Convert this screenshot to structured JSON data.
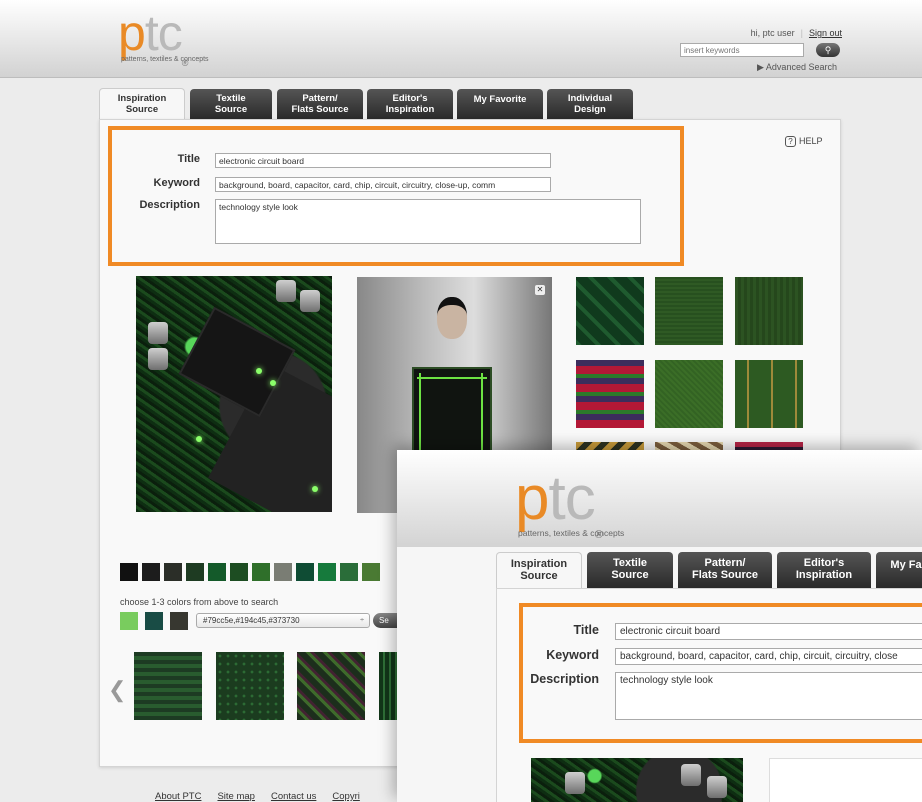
{
  "brand": {
    "logo_p": "p",
    "logo_tc": "tc",
    "logo_reg": "®",
    "tagline": "patterns, textiles & concepts",
    "orange": "#f08a25"
  },
  "user": {
    "greeting": "hi, ptc user",
    "separator": "|",
    "sign_out": "Sign out"
  },
  "search": {
    "placeholder": "insert keywords",
    "button_icon": "search-icon",
    "advanced": "▶ Advanced Search"
  },
  "tabs": [
    {
      "line1": "Inspiration",
      "line2": "Source"
    },
    {
      "line1": "Textile",
      "line2": "Source"
    },
    {
      "line1": "Pattern/",
      "line2": "Flats Source"
    },
    {
      "line1": "Editor's",
      "line2": "Inspiration"
    },
    {
      "line1": "My Favorite",
      "line2": ""
    },
    {
      "line1": "Individual",
      "line2": "Design"
    }
  ],
  "help": {
    "icon": "?",
    "label": "HELP"
  },
  "form": {
    "title_label": "Title",
    "title_value": "electronic circuit board",
    "keyword_label": "Keyword",
    "keyword_value": "background, board, capacitor, card, chip, circuit, circuitry, close-up, comm",
    "description_label": "Description",
    "description_value": "technology style look"
  },
  "close_icon": "✕",
  "colors": {
    "palette": [
      "#111111",
      "#1c1c1c",
      "#2b2e28",
      "#1e3b22",
      "#145a2a",
      "#1d4d22",
      "#2f6f2a",
      "#7a7d74",
      "#0f4c34",
      "#167a3c",
      "#2a6d39",
      "#4a7a33"
    ],
    "choose_text": "choose 1-3 colors from above to search",
    "selected": [
      "#79cc5e",
      "#194c45",
      "#373730"
    ],
    "select_value": "#79cc5e,#194c45,#373730",
    "select_arrow": "÷",
    "search_button": "Se"
  },
  "carousel": {
    "prev_icon": "❮"
  },
  "footer": {
    "links": [
      "About PTC",
      "Site map",
      "Contact us",
      "Copyri"
    ]
  },
  "overlay": {
    "tabs": [
      {
        "line1": "Inspiration",
        "line2": "Source"
      },
      {
        "line1": "Textile",
        "line2": "Source"
      },
      {
        "line1": "Pattern/",
        "line2": "Flats Source"
      },
      {
        "line1": "Editor's",
        "line2": "Inspiration"
      },
      {
        "line1": "My Fa",
        "line2": ""
      }
    ],
    "title_label": "Title",
    "title_value": "electronic circuit board",
    "keyword_label": "Keyword",
    "keyword_value": "background, board, capacitor, card, chip, circuit, circuitry, close",
    "description_label": "Description",
    "description_value": "technology style look"
  }
}
